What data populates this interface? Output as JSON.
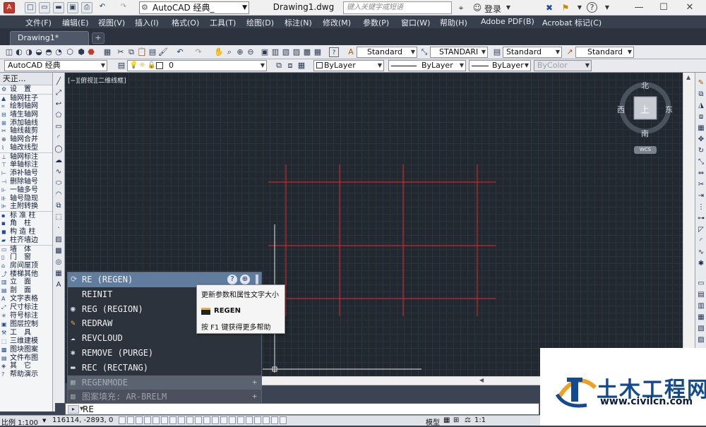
{
  "titlebar": {
    "workspace": "AutoCAD 经典",
    "workspace_suffix": "_",
    "doc_title": "Drawing1.dwg",
    "search_placeholder": "键入关键字或短语",
    "login": "登录",
    "win_min": "—",
    "win_max": "☐",
    "win_close": "✕"
  },
  "menubar": {
    "items": [
      "文件(F)",
      "编辑(E)",
      "视图(V)",
      "插入(I)",
      "格式(O)",
      "工具(T)",
      "绘图(D)",
      "标注(N)",
      "修改(M)",
      "参数(P)",
      "窗口(W)",
      "帮助(H)",
      "Adobe PDF(B)",
      "Acrobat 标记(C)"
    ]
  },
  "tabs": {
    "active": "Drawing1*",
    "new_tab": "+"
  },
  "toolbar1": {
    "text_style": "Standard",
    "dim_style": "STANDARI",
    "table_style": "Standard",
    "mleader_style": "Standard"
  },
  "toolbar2": {
    "workspace": "AutoCAD 经典",
    "layer": "0",
    "color": "ByLayer",
    "linetype": "ByLayer",
    "lineweight": "ByLayer",
    "plotstyle": "ByColor"
  },
  "leftpanel": {
    "header": "天正...",
    "items": [
      "设　置",
      "轴网柱子",
      "绘制轴网",
      "墙生轴网",
      "添加轴线",
      "轴线裁剪",
      "轴网合并",
      "轴改线型",
      "轴网标注",
      "单轴标注",
      "添补轴号",
      "删除轴号",
      "一轴多号",
      "轴号隐现",
      "主附转换",
      "标 准 柱",
      "角　柱",
      "构 造 柱",
      "柱齐墙边",
      "墙　体",
      "门　窗",
      "房间屋顶",
      "楼梯其他",
      "立　面",
      "剖　面",
      "文字表格",
      "尺寸标注",
      "符号标注",
      "图层控制",
      "工　具",
      "三维建模",
      "图块图案",
      "文件布图",
      "其　它",
      "帮助演示"
    ]
  },
  "canvas": {
    "viewport_label": "[−][俯视][二维线框]",
    "compass": {
      "north": "北",
      "south": "南",
      "east": "东",
      "west": "西",
      "top": "上",
      "wcs": "WCS"
    },
    "grid_color": "#c62828"
  },
  "autocomplete": {
    "items": [
      {
        "label": "RE (REGEN)",
        "icon": "regen-icon"
      },
      {
        "label": "REINIT",
        "icon": ""
      },
      {
        "label": "REG (REGION)",
        "icon": "region-icon"
      },
      {
        "label": "REDRAW",
        "icon": "redraw-icon"
      },
      {
        "label": "REVCLOUD",
        "icon": "revcloud-icon"
      },
      {
        "label": "REMOVE (PURGE)",
        "icon": "purge-icon"
      },
      {
        "label": "REC (RECTANG)",
        "icon": "rectang-icon"
      },
      {
        "label": "REGENMODE",
        "icon": "sysvar-icon"
      },
      {
        "label": "图案填充: AR-BRELM",
        "icon": "hatch-icon"
      }
    ],
    "tooltip": {
      "description": "更新参数和属性文字大小",
      "command": "REGEN",
      "help": "按 F1 键获得更多帮助"
    }
  },
  "cmdline": {
    "value": "RE",
    "prompt_icon": "▸"
  },
  "statusbar": {
    "scale": "比例 1:100",
    "coords": "116114, -2893, 0",
    "model": "模型",
    "annot_scale": "1:1"
  },
  "watermark": {
    "title": "土木工程网",
    "url": "www.civilcn.com"
  }
}
